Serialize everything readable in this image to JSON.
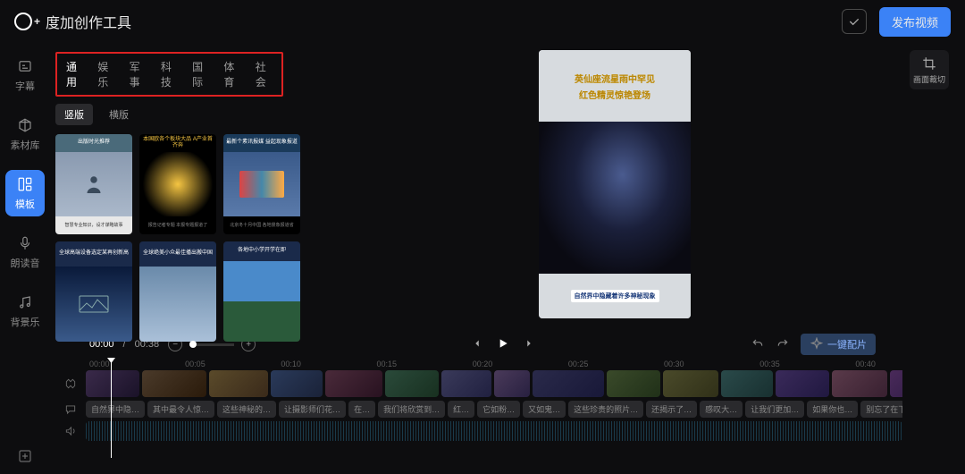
{
  "app": {
    "name": "度加创作工具"
  },
  "topbar": {
    "publish_label": "发布视频"
  },
  "rail": {
    "items": [
      {
        "label": "字幕"
      },
      {
        "label": "素材库"
      },
      {
        "label": "模板"
      },
      {
        "label": "朗读音"
      },
      {
        "label": "背景乐"
      }
    ]
  },
  "categories": {
    "items": [
      "通用",
      "娱乐",
      "军事",
      "科技",
      "国际",
      "体育",
      "社会"
    ],
    "active": "通用"
  },
  "orientation": {
    "vertical": "竖版",
    "horizontal": "横版",
    "active": "竖版"
  },
  "templates": {
    "cards": [
      {
        "title": "出版时光推荐"
      },
      {
        "title": "本国欧各个板块大品 A产业首齐奔"
      },
      {
        "title": "最新个素讯报媒 益起现象报道"
      },
      {
        "title": "全球高端设备选定某再创新高"
      },
      {
        "title": "全球绝美小众最佳播出搬中国"
      },
      {
        "title": "各地中小学开学在即"
      }
    ]
  },
  "preview": {
    "top_line1": "英仙座流星雨中罕见",
    "top_line2": "红色精灵惊艳登场",
    "bottom_caption": "自然界中隐藏着许多神秘现象"
  },
  "crop": {
    "label": "画面裁切"
  },
  "transport": {
    "current": "00:00",
    "total": "00:38",
    "ai_label": "一键配片"
  },
  "ruler": {
    "ticks": [
      "00:00",
      "00:05",
      "00:10",
      "00:15",
      "00:20",
      "00:25",
      "00:30",
      "00:35",
      "00:40"
    ]
  },
  "subtitles": {
    "chips": [
      "自然界中隐…",
      "其中最令人惊…",
      "这些神秘的…",
      "让摄影师们花…",
      "在…",
      "我们将欣赏到…",
      "红…",
      "它如粉…",
      "又如鬼…",
      "这些珍贵的照片…",
      "还揭示了…",
      "感叹大…",
      "让我们更加…",
      "如果你也…",
      "别忘了在下方…"
    ]
  },
  "clips": {
    "widths": [
      60,
      72,
      66,
      58,
      64,
      60,
      56,
      40,
      80,
      60,
      62,
      58,
      60,
      62,
      58
    ]
  }
}
